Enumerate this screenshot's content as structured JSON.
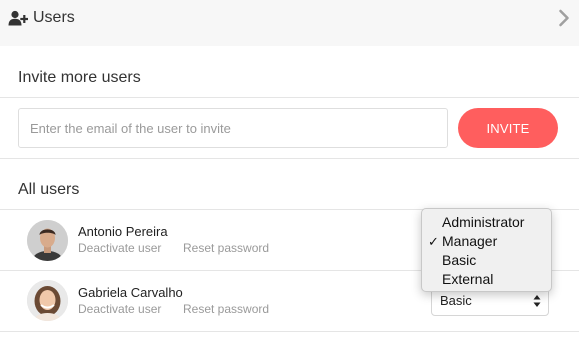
{
  "header": {
    "title": "Users",
    "icon": "add-user-icon",
    "chevron_icon": "chevron-right-icon"
  },
  "invite": {
    "title": "Invite more users",
    "email_placeholder": "Enter the email of the user to invite",
    "email_value": "",
    "button_label": "INVITE"
  },
  "all_users": {
    "title": "All users",
    "users": [
      {
        "name": "Antonio Pereira",
        "deactivate_label": "Deactivate user",
        "reset_label": "Reset password",
        "role": "Manager"
      },
      {
        "name": "Gabriela Carvalho",
        "deactivate_label": "Deactivate user",
        "reset_label": "Reset password",
        "role": "Basic"
      }
    ]
  },
  "role_dropdown": {
    "options": [
      "Administrator",
      "Manager",
      "Basic",
      "External"
    ],
    "selected": "Manager",
    "check_glyph": "✓"
  },
  "colors": {
    "accent": "#ff5e5e",
    "header_bg": "#f7f7f7",
    "muted_text": "#9a9a9a"
  }
}
